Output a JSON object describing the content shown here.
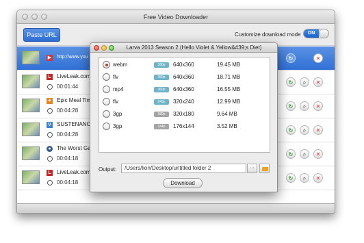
{
  "window": {
    "title": "Free Video Downloader"
  },
  "toolbar": {
    "paste_label": "Paste URL",
    "mode_label": "Customize download mode",
    "toggle_label": "ON"
  },
  "list": {
    "selected_url": "http://www.you",
    "items": [
      {
        "source": "LiveLeak.com",
        "duration": "00:01:44"
      },
      {
        "source": "Epic Meal Tim",
        "duration": "00:04:28"
      },
      {
        "source": "SUSTENANCE",
        "duration": "00:04:28"
      },
      {
        "source": "The Worst Ga",
        "duration": "00:04:18"
      },
      {
        "source": "LiveLeak.com",
        "duration": "00:04:18"
      }
    ]
  },
  "dialog": {
    "title": "Larva 2013 Season 2 (Hello Violet & Yellow&#39;s Diet)",
    "formats": [
      {
        "format": "webm",
        "quality": "360p",
        "resolution": "640x360",
        "size": "19.45 MB",
        "checked": true
      },
      {
        "format": "flv",
        "quality": "360p",
        "resolution": "640x360",
        "size": "18.71 MB",
        "checked": false
      },
      {
        "format": "mp4",
        "quality": "360p",
        "resolution": "640x360",
        "size": "16.55 MB",
        "checked": false
      },
      {
        "format": "flv",
        "quality": "240p",
        "resolution": "320x240",
        "size": "12.99 MB",
        "checked": false
      },
      {
        "format": "3gp",
        "quality": "180p",
        "resolution": "320x180",
        "size": "9.64 MB",
        "checked": false
      },
      {
        "format": "3gp",
        "quality": "144p",
        "resolution": "176x144",
        "size": "3.52 MB",
        "checked": false
      }
    ],
    "output_label": "Output:",
    "output_path": "/Users/lion/Desktop/untitled folder 2",
    "more_label": "···",
    "download_label": "Download"
  }
}
